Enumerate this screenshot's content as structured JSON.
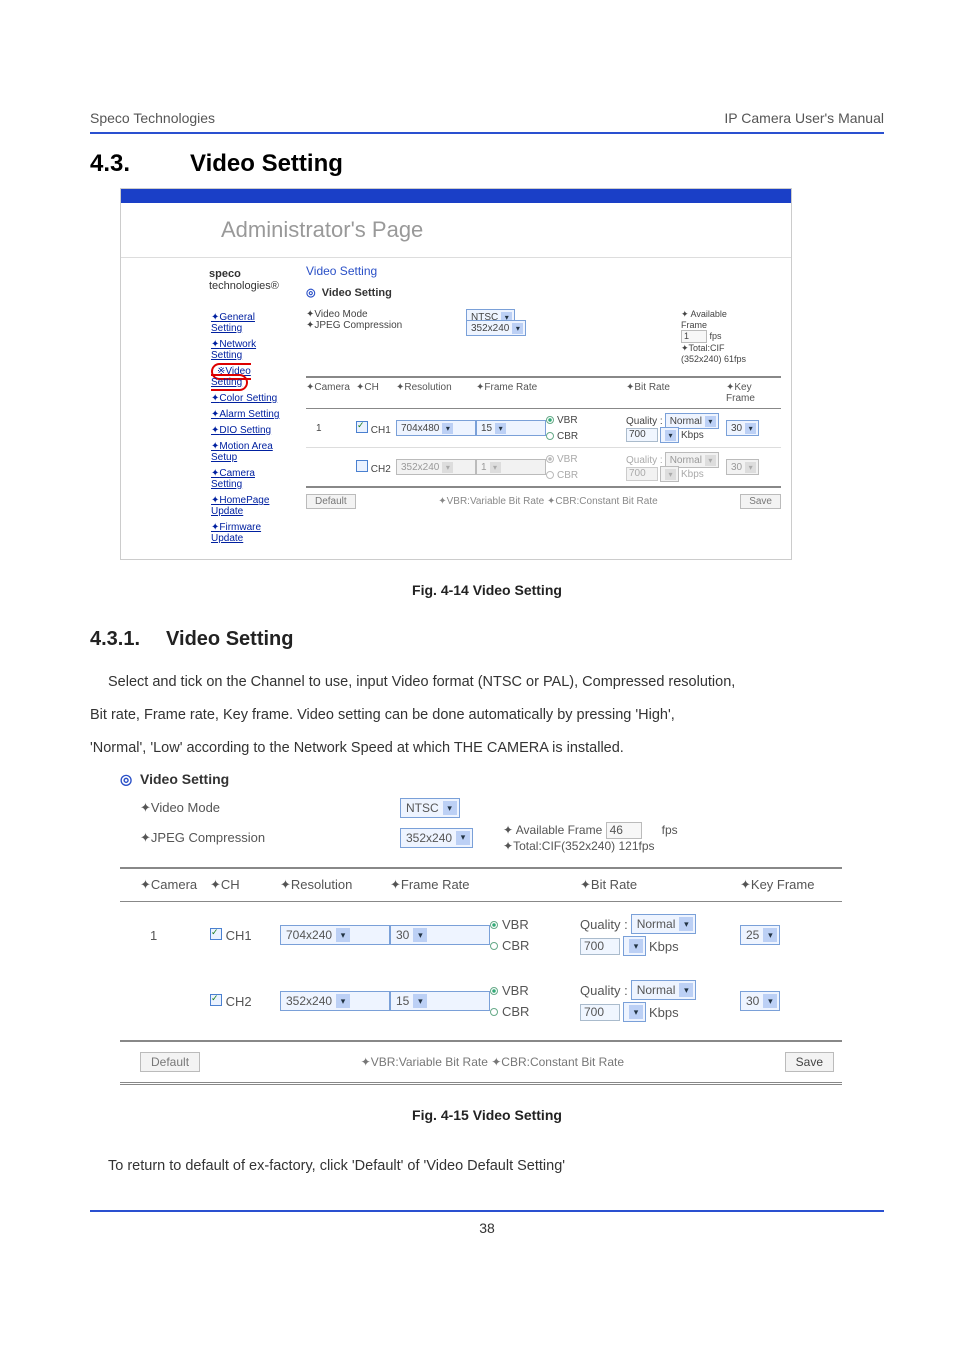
{
  "header": {
    "left": "Speco Technologies",
    "right": "IP Camera User's Manual"
  },
  "section": {
    "num": "4.3.",
    "title": "Video Setting"
  },
  "admin": {
    "title": "Administrator's  Page",
    "brand_bold": "speco",
    "brand_rest": " technologies®",
    "nav": {
      "general": "General Setting",
      "network": "Network Setting",
      "video": "Video Setting",
      "color": "Color Setting",
      "alarm": "Alarm Setting",
      "dio": "DIO Setting",
      "motion": "Motion Area Setup",
      "camera": "Camera Setting",
      "homepage": "HomePage Update",
      "firmware": "Firmware Update"
    },
    "panel_title": "Video Setting",
    "vs_head": "Video Setting",
    "bullet": "◎",
    "lbl_video_mode": "✦Video Mode",
    "lbl_jpeg": "✦JPEG Compression",
    "mode_select": "NTSC",
    "jpeg_select": "352x240",
    "avail": {
      "l1": "✦ Available",
      "l2": "Frame",
      "val": "1",
      "fps": "fps",
      "l3": "✦Total:CIF",
      "l4": "(352x240) 61fps"
    },
    "col_camera": "✦Camera",
    "col_ch": "✦CH",
    "col_res": "✦Resolution",
    "col_frame": "✦Frame Rate",
    "col_bit": "✦Bit Rate",
    "col_key": "✦Key Frame",
    "cam1": "1",
    "ch1": "CH1",
    "ch2": "CH2",
    "res1": "704x480",
    "res2": "352x240",
    "fr1": "15",
    "fr2": "1",
    "vbr": "VBR",
    "cbr": "CBR",
    "quality_lbl": "Quality :",
    "quality_val": "Normal",
    "kbps_val": "700",
    "kbps": "Kbps",
    "key1": "30",
    "key2": "30",
    "footer_note": "✦VBR:Variable Bit Rate ✦CBR:Constant Bit Rate",
    "btn_default": "Default",
    "btn_save": "Save"
  },
  "caption1": "Fig.   4-14   Video Setting",
  "subsect": {
    "num": "4.3.1.",
    "title": "Video Setting"
  },
  "body": {
    "p1": "Select and tick on the Channel to use, input Video format (NTSC or PAL), Compressed resolution,",
    "p2": "Bit rate, Frame rate, Key frame. Video setting can be done automatically by pressing 'High',",
    "p3": "'Normal', 'Low' according to the Network Speed at which THE CAMERA is installed."
  },
  "vs2": {
    "head": "Video Setting",
    "bullet": "◎",
    "lbl_video_mode": "✦Video Mode",
    "lbl_jpeg": "✦JPEG Compression",
    "mode_select": "NTSC",
    "jpeg_select": "352x240",
    "avail_lbl": "✦ Available Frame",
    "avail_val": "46",
    "fps": "fps",
    "total": "✦Total:CIF(352x240) 121fps",
    "col_camera": "✦Camera",
    "col_ch": "✦CH",
    "col_res": "✦Resolution",
    "col_frame": "✦Frame Rate",
    "col_bit": "✦Bit Rate",
    "col_key": "✦Key Frame",
    "cam1": "1",
    "ch1": "CH1",
    "ch2": "CH2",
    "res1": "704x240",
    "res2": "352x240",
    "fr1": "30",
    "fr2": "15",
    "vbr": "VBR",
    "cbr": "CBR",
    "quality_lbl": "Quality :",
    "quality_val": "Normal",
    "kbps_val": "700",
    "kbps": "Kbps",
    "key1": "25",
    "key2": "30",
    "footer_note": "✦VBR:Variable Bit Rate ✦CBR:Constant Bit Rate",
    "btn_default": "Default",
    "btn_save": "Save"
  },
  "caption2": "Fig. 4-15   Video Setting",
  "bottom_text": "To return to default of ex-factory, click 'Default' of 'Video Default Setting'",
  "page_num": "38"
}
